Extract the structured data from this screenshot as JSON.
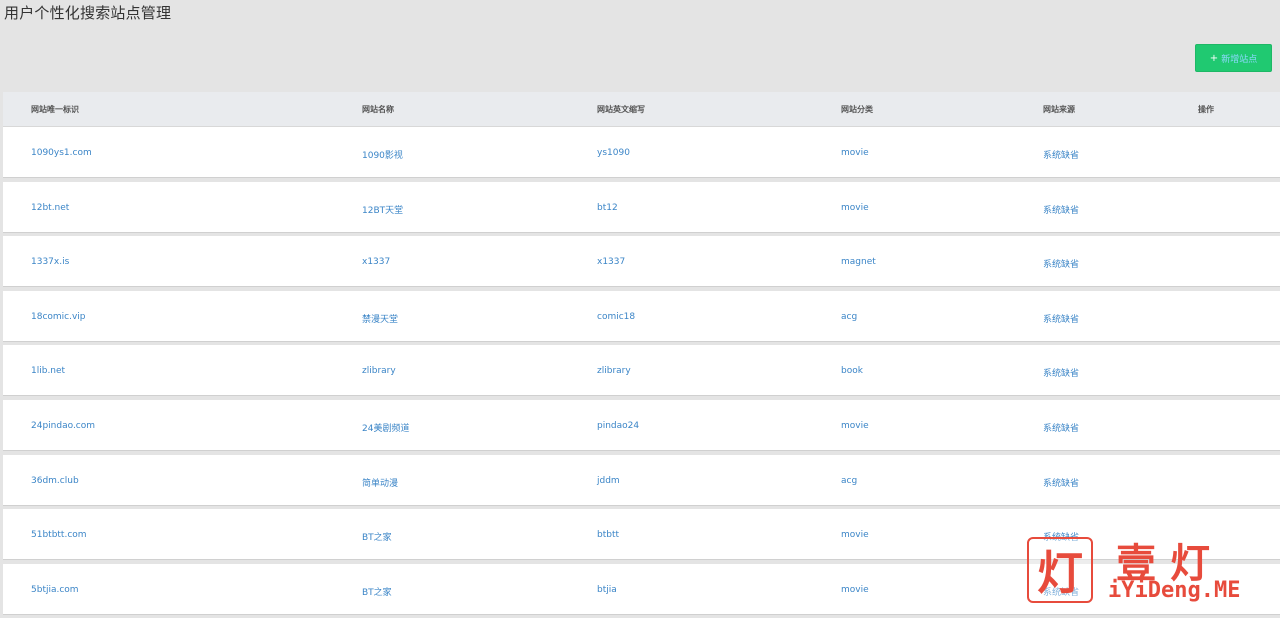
{
  "page": {
    "title": "用户个性化搜索站点管理",
    "add_button": "新增站点"
  },
  "table": {
    "headers": [
      "网站唯一标识",
      "网站名称",
      "网站英文缩写",
      "网站分类",
      "网站来源",
      "操作"
    ],
    "rows": [
      [
        "1090ys1.com",
        "1090影视",
        "ys1090",
        "movie",
        "系统缺省",
        ""
      ],
      [
        "12bt.net",
        "12BT天堂",
        "bt12",
        "movie",
        "系统缺省",
        ""
      ],
      [
        "1337x.is",
        "x1337",
        "x1337",
        "magnet",
        "系统缺省",
        ""
      ],
      [
        "18comic.vip",
        "禁漫天堂",
        "comic18",
        "acg",
        "系统缺省",
        ""
      ],
      [
        "1lib.net",
        "zlibrary",
        "zlibrary",
        "book",
        "系统缺省",
        ""
      ],
      [
        "24pindao.com",
        "24美剧频道",
        "pindao24",
        "movie",
        "系统缺省",
        ""
      ],
      [
        "36dm.club",
        "简单动漫",
        "jddm",
        "acg",
        "系统缺省",
        ""
      ],
      [
        "51btbtt.com",
        "BT之家",
        "btbtt",
        "movie",
        "系统缺省",
        ""
      ],
      [
        "5btjia.com",
        "BT之家",
        "btjia",
        "movie",
        "系统缺省",
        ""
      ]
    ]
  },
  "watermark": {
    "logo_char": "灯",
    "cn_text": "壹灯",
    "en_text": "iYiDeng.ME"
  },
  "colors": {
    "accent": "#20c971",
    "link": "#3b85c7",
    "watermark": "#e74b3c"
  }
}
